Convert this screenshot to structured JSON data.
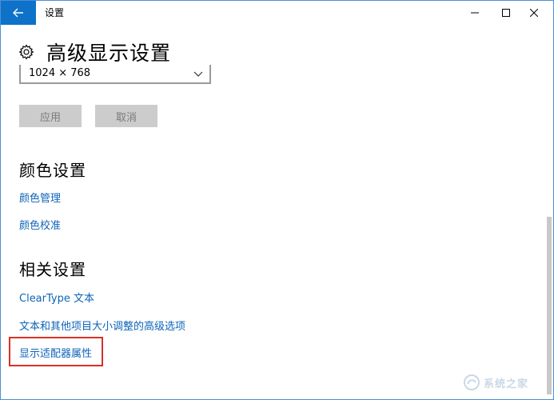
{
  "window": {
    "title": "设置",
    "accent_color": "#0e72c8",
    "controls": {
      "minimize_icon": "minimize-icon",
      "maximize_icon": "maximize-icon",
      "close_icon": "close-icon"
    }
  },
  "header": {
    "title": "高级显示设置",
    "icon": "gear-icon"
  },
  "resolution": {
    "selected_value": "1024 × 768"
  },
  "buttons": {
    "apply_label": "应用",
    "cancel_label": "取消"
  },
  "color_settings": {
    "heading": "颜色设置",
    "links": [
      "颜色管理",
      "颜色校准"
    ]
  },
  "related_settings": {
    "heading": "相关设置",
    "links": [
      "ClearType 文本",
      "文本和其他项目大小调整的高级选项",
      "显示适配器属性"
    ]
  },
  "highlight": {
    "color": "#d93025"
  },
  "watermark": {
    "text": "系统之家"
  }
}
